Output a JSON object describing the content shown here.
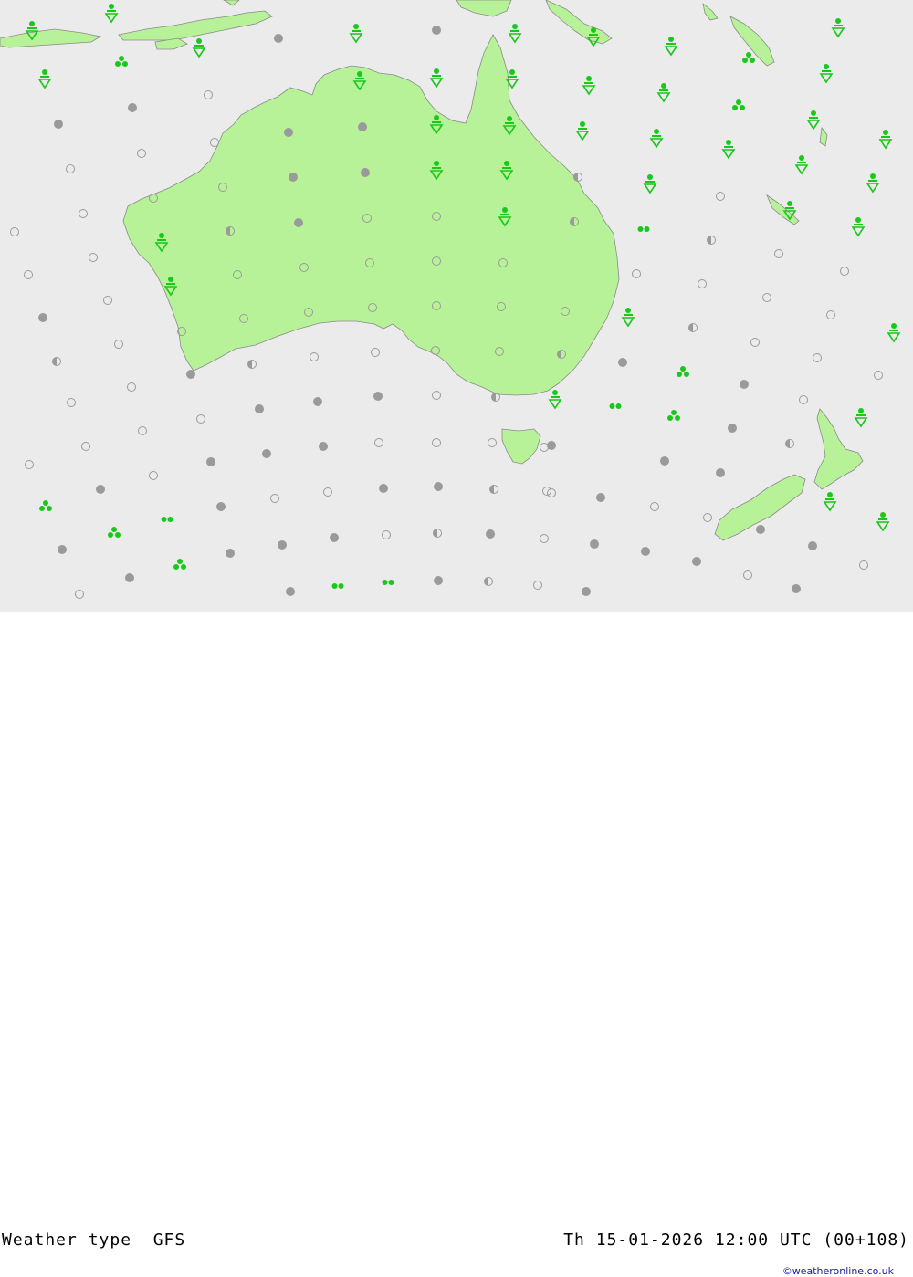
{
  "footer": {
    "left_label": "Weather type  GFS",
    "right_label": "Th 15-01-2026 12:00 UTC (00+108)",
    "credit": "©weatheronline.co.uk"
  },
  "colors": {
    "sea": "#ebebeb",
    "land": "#b8f298",
    "coast": "#8a8a8a",
    "symbol_green": "#1ac81a",
    "symbol_grey": "#9a9a9a"
  },
  "symbol_types": [
    "clear-ring",
    "overcast-dot",
    "partly-cloudy-half",
    "rain-shower",
    "drizzle-double",
    "snow-cluster"
  ]
}
